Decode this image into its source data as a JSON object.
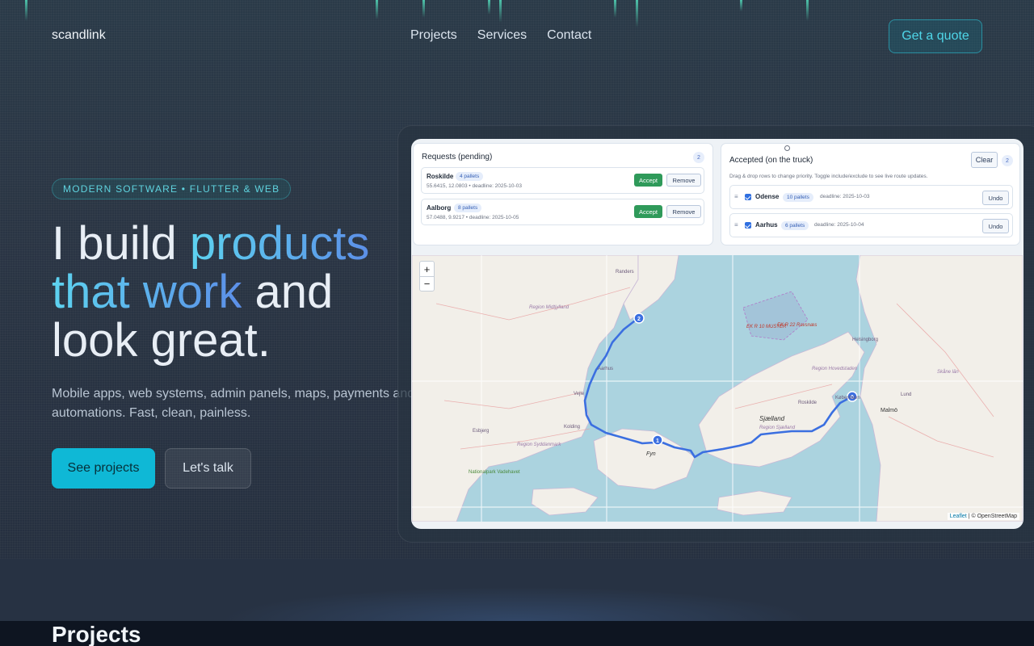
{
  "nav": {
    "logo": "scandlink",
    "links": [
      "Projects",
      "Services",
      "Contact"
    ],
    "cta": "Get a quote"
  },
  "hero": {
    "eyebrow": "MODERN SOFTWARE • FLUTTER & WEB",
    "headline_1": "I build ",
    "headline_accent_1": "products",
    "headline_accent_2": "that work",
    "headline_2": " and",
    "headline_3": "look great.",
    "subtext": "Mobile apps, web systems, admin panels, maps, payments and automations. Fast, clean, painless.",
    "primary_button": "See projects",
    "secondary_button": "Let's talk"
  },
  "preview": {
    "pending": {
      "title": "Requests (pending)",
      "count": "2",
      "rows": [
        {
          "name": "Roskilde",
          "pallets": "4 pallets",
          "meta": "55.6415, 12.0803 • deadline: 2025-10-03",
          "accept": "Accept",
          "remove": "Remove"
        },
        {
          "name": "Aalborg",
          "pallets": "8 pallets",
          "meta": "57.0488, 9.9217 • deadline: 2025-10-05",
          "accept": "Accept",
          "remove": "Remove"
        }
      ]
    },
    "accepted": {
      "title": "Accepted (on the truck)",
      "clear": "Clear",
      "count": "2",
      "hint": "Drag & drop rows to change priority. Toggle include/exclude to see live route updates.",
      "rows": [
        {
          "name": "Odense",
          "pallets": "10 pallets",
          "meta": "deadline: 2025-10-03",
          "undo": "Undo"
        },
        {
          "name": "Aarhus",
          "pallets": "6 pallets",
          "meta": "deadline: 2025-10-04",
          "undo": "Undo"
        }
      ]
    },
    "map": {
      "zoom_in": "+",
      "zoom_out": "−",
      "attribution_leaflet": "Leaflet",
      "attribution_osm": " | © OpenStreetMap",
      "marker_labels": [
        "1",
        "2",
        "0"
      ],
      "place_labels": [
        "Randers",
        "Region Midtjylland",
        "Aarhus",
        "Vejle",
        "Kolding",
        "Esbjerg",
        "Region Syddanmark",
        "Nationalpark Vadehavet",
        "Fyn",
        "Sjælland",
        "Region Sjælland",
        "Roskilde",
        "København",
        "Region Hovedstaden",
        "Helsingborg",
        "Skåne län",
        "Lund",
        "Malmö",
        "EK R 10 MUSTER",
        "EK R 22 Ravsnæs"
      ],
      "colors": {
        "water": "#abd3df",
        "land": "#f2efe9",
        "route": "#3b6fe0"
      }
    }
  },
  "projects": {
    "title": "Projects"
  }
}
